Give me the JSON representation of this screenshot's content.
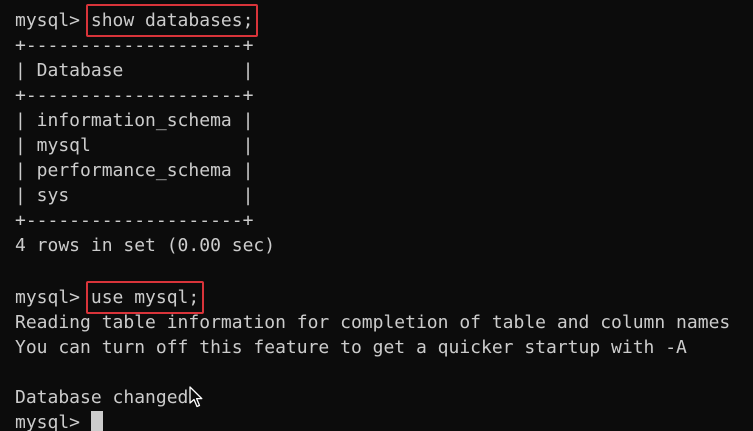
{
  "terminal": {
    "prompt": "mysql> ",
    "command1": "show databases;",
    "border_line": "+--------------------+",
    "header_row": "| Database           |",
    "rows": [
      "| information_schema |",
      "| mysql              |",
      "| performance_schema |",
      "| sys                |"
    ],
    "result_summary": "4 rows in set (0.00 sec)",
    "command2": "use mysql;",
    "info_line1": "Reading table information for completion of table and column names",
    "info_line2": "You can turn off this feature to get a quicker startup with -A",
    "changed_msg": "Database changed"
  },
  "colors": {
    "background": "#0c0c0c",
    "text": "#cccccc",
    "highlight_box": "#d9343a"
  },
  "icons": {
    "pointer": "mouse-pointer-icon"
  }
}
